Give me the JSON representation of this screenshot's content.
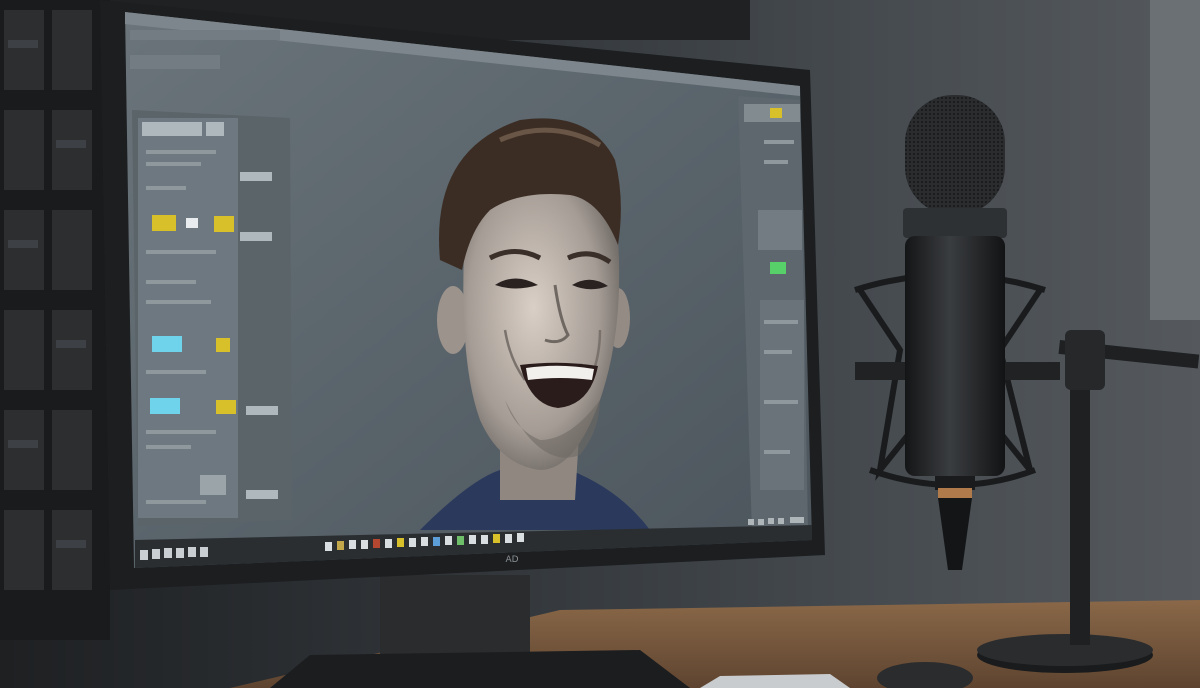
{
  "scene": {
    "description_items": [
      "monitor",
      "software-window",
      "smiling-man-portrait",
      "condenser-microphone",
      "shock-mount",
      "mic-stand",
      "wooden-desk",
      "keyboard",
      "mouse",
      "acoustic-panels"
    ],
    "colors": {
      "wall": "#3a3e42",
      "screen": "#5c666d",
      "bezel": "#1c1e20",
      "desk": "#7a5a40",
      "mic_body": "#202224",
      "panel_ui": "#6e7880",
      "accent_yellow": "#d8c02a",
      "accent_cyan": "#6fd3ec"
    }
  },
  "monitor": {
    "brand_logo": "AD"
  }
}
